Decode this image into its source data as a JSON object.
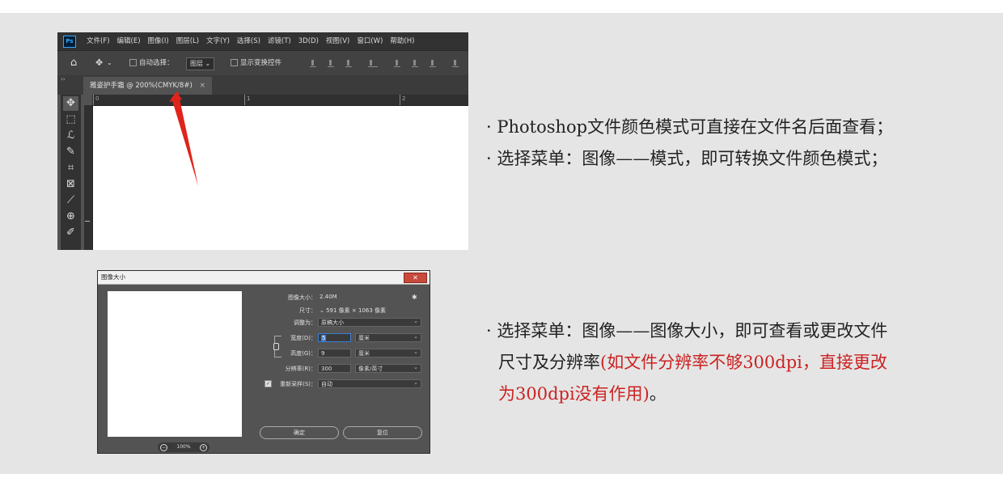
{
  "photoshop": {
    "logo": "Ps",
    "menu": [
      "文件(F)",
      "编辑(E)",
      "图像(I)",
      "图层(L)",
      "文字(Y)",
      "选择(S)",
      "滤镜(T)",
      "3D(D)",
      "视图(V)",
      "窗口(W)",
      "帮助(H)"
    ],
    "options": {
      "auto_select_label": "自动选择：",
      "layer_select": "图层",
      "show_transform_label": "显示变换控件"
    },
    "tab": {
      "title": "雅姿护手霜 @ 200%(CMYK/8#)",
      "close": "×"
    },
    "collapse": "››",
    "ruler_marks": [
      "0",
      "1",
      "2"
    ]
  },
  "dialog": {
    "title": "图像大小",
    "close": "✕",
    "image_size_label": "图像大小：",
    "image_size_value": "2.40M",
    "dimensions_label": "尺寸：",
    "dimensions_value": "591 像素 × 1063 像素",
    "fit_to_label": "调整为：",
    "fit_to_value": "原稿大小",
    "width_label": "宽度(D)：",
    "width_value": "5",
    "width_unit": "厘米",
    "height_label": "高度(G)：",
    "height_value": "9",
    "height_unit": "厘米",
    "resolution_label": "分辨率(R)：",
    "resolution_value": "300",
    "resolution_unit": "像素/英寸",
    "resample_label": "重新采样(S)：",
    "resample_value": "自动",
    "zoom_value": "100%",
    "ok_label": "确定",
    "reset_label": "复位"
  },
  "notes": {
    "line1": "· Photoshop文件颜色模式可直接在文件名后面查看；",
    "line2": "· 选择菜单：图像——模式，即可转换文件颜色模式；",
    "line3": "· 选择菜单：图像——图像大小，即可查看或更改文件",
    "line4_black": "尺寸及分辨率",
    "line4_red": "(如文件分辨率不够300dpi，直接更改",
    "line5_red": "为300dpi没有作用)",
    "line5_black": "。"
  },
  "colors": {
    "accent_red": "#cc2222",
    "arrow_red": "#e0231b",
    "ps_background": "#535353",
    "panel_background": "#e5e5e5"
  },
  "icons": {
    "home": "home-icon",
    "move": "move-icon",
    "marquee": "rect-marquee-icon",
    "lasso": "lasso-icon",
    "quick_select": "quick-select-icon",
    "crop": "crop-icon",
    "frame": "frame-icon",
    "eyedropper": "eyedropper-icon",
    "healing": "healing-brush-icon",
    "brush": "brush-icon"
  }
}
